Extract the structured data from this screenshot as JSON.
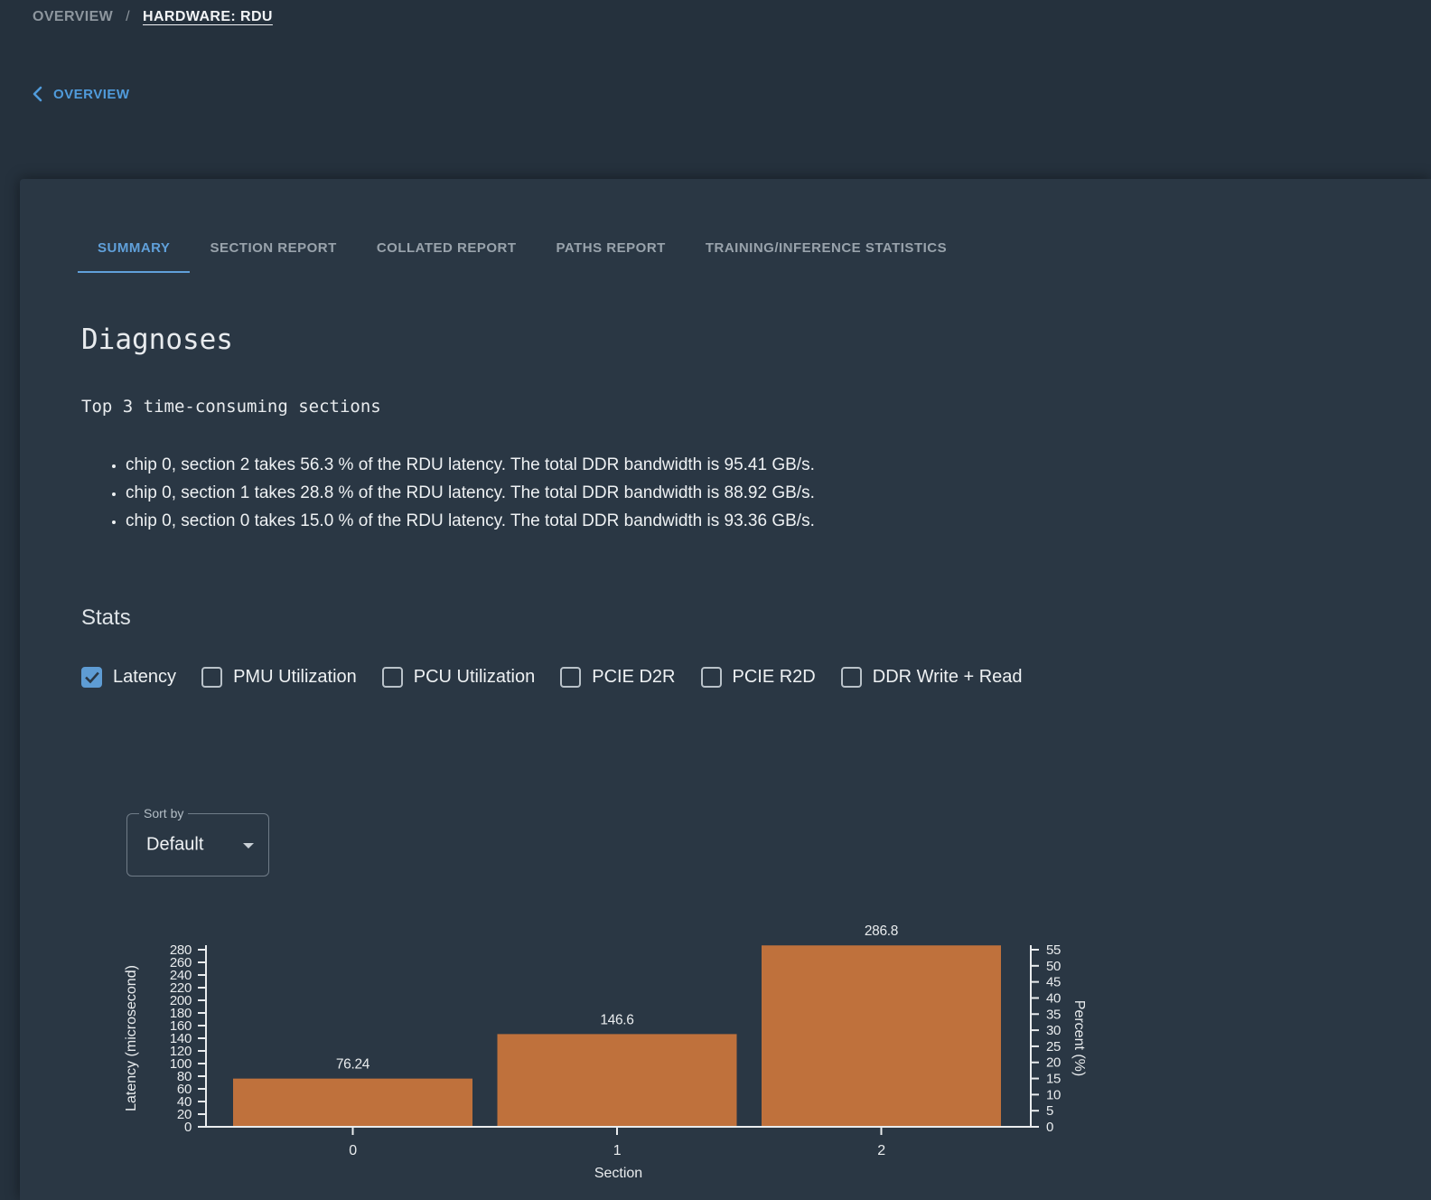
{
  "page": {
    "bg": "#25313d",
    "card_bg": "#2a3744",
    "accent_blue": "#5e9cd4",
    "text_primary": "#eef1f3",
    "text_secondary": "#8d969e"
  },
  "breadcrumb": {
    "parent": "OVERVIEW",
    "separator": "/",
    "current": "HARDWARE: RDU"
  },
  "back_link": {
    "label": "OVERVIEW",
    "icon": "chevron-left-icon"
  },
  "tabs": [
    {
      "label": "SUMMARY",
      "active": true
    },
    {
      "label": "SECTION REPORT",
      "active": false
    },
    {
      "label": "COLLATED REPORT",
      "active": false
    },
    {
      "label": "PATHS REPORT",
      "active": false
    },
    {
      "label": "TRAINING/INFERENCE STATISTICS",
      "active": false
    }
  ],
  "diagnoses": {
    "title": "Diagnoses",
    "subtitle": "Top 3 time-consuming sections",
    "bullets": [
      "chip 0, section 2 takes 56.3 % of the RDU latency. The total DDR bandwidth is 95.41 GB/s.",
      "chip 0, section 1 takes 28.8 % of the RDU latency. The total DDR bandwidth is 88.92 GB/s.",
      "chip 0, section 0 takes 15.0 % of the RDU latency. The total DDR bandwidth is 93.36 GB/s."
    ]
  },
  "stats": {
    "title": "Stats",
    "options": [
      {
        "label": "Latency",
        "checked": true
      },
      {
        "label": "PMU Utilization",
        "checked": false
      },
      {
        "label": "PCU Utilization",
        "checked": false
      },
      {
        "label": "PCIE D2R",
        "checked": false
      },
      {
        "label": "PCIE R2D",
        "checked": false
      },
      {
        "label": "DDR Write + Read",
        "checked": false
      }
    ]
  },
  "sort_by": {
    "label": "Sort by",
    "value": "Default",
    "icon": "dropdown-arrow-icon"
  },
  "chart_data": {
    "type": "bar",
    "categories": [
      "0",
      "1",
      "2"
    ],
    "values": [
      76.24,
      146.6,
      286.8
    ],
    "bar_labels": [
      "76.24",
      "146.6",
      "286.8"
    ],
    "title": "",
    "xlabel": "Section",
    "ylabel_left": "Latency (microsecond)",
    "ylabel_right": "Percent (%)",
    "left_axis": {
      "min": 0,
      "max": 280,
      "step": 20
    },
    "right_axis": {
      "min": 0,
      "max": 55,
      "step": 5
    },
    "grid": false,
    "legend": null,
    "bar_color": "#bf713c",
    "axis_color": "#e9ecee"
  }
}
